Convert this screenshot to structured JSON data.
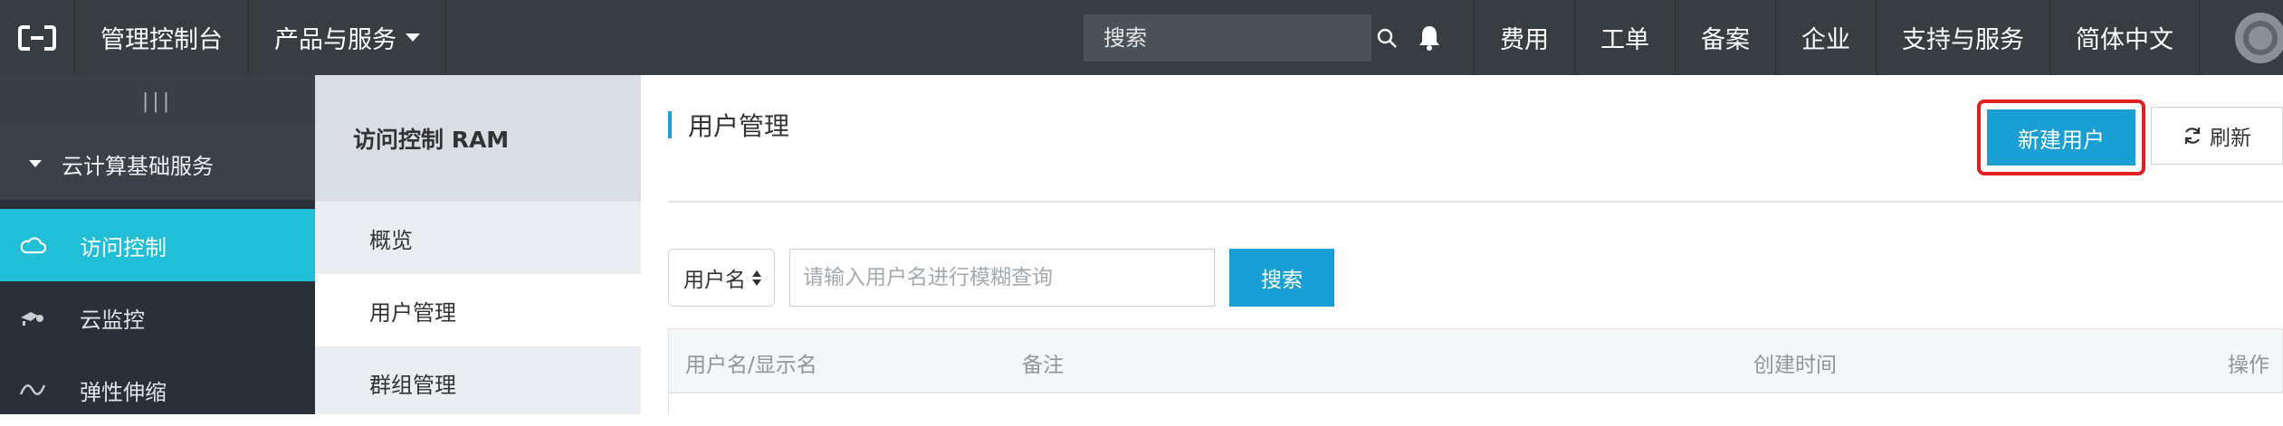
{
  "topbar": {
    "console_label": "管理控制台",
    "products_label": "产品与服务",
    "search_placeholder": "搜索",
    "nav": [
      "费用",
      "工单",
      "备案",
      "企业",
      "支持与服务",
      "简体中文"
    ]
  },
  "sidebar": {
    "collapse_label": "|||",
    "group_label": "云计算基础服务",
    "items": [
      {
        "label": "访问控制",
        "icon": "cloud-icon",
        "active": true
      },
      {
        "label": "云监控",
        "icon": "monitor-eye-icon",
        "active": false
      },
      {
        "label": "弹性伸缩",
        "icon": "scaling-icon",
        "active": false
      }
    ]
  },
  "subnav": {
    "title": "访问控制 RAM",
    "items": [
      {
        "label": "概览",
        "active": false
      },
      {
        "label": "用户管理",
        "active": true
      },
      {
        "label": "群组管理",
        "active": false
      }
    ]
  },
  "main": {
    "page_title": "用户管理",
    "new_user_label": "新建用户",
    "refresh_label": "刷新",
    "filter_select_value": "用户名",
    "filter_placeholder": "请输入用户名进行模糊查询",
    "search_button_label": "搜索",
    "table_headers": [
      "用户名/显示名",
      "备注",
      "创建时间",
      "操作"
    ]
  },
  "colors": {
    "topbar_bg": "#373d41",
    "sidebar_bg": "#293038",
    "active_item": "#20bfd7",
    "primary_button": "#1a9fd5",
    "highlight_outline": "#e02020"
  }
}
